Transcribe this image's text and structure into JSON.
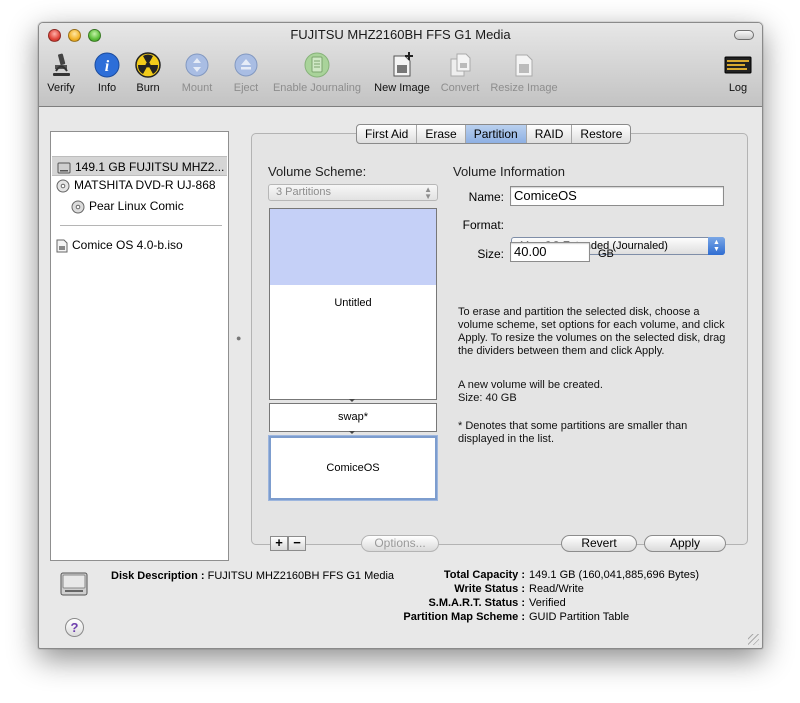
{
  "window": {
    "title": "FUJITSU MHZ2160BH FFS G1 Media"
  },
  "toolbar": {
    "items": [
      {
        "label": "Verify",
        "icon": "microscope-icon",
        "enabled": true
      },
      {
        "label": "Info",
        "icon": "info-icon",
        "enabled": true
      },
      {
        "label": "Burn",
        "icon": "burn-icon",
        "enabled": true
      },
      {
        "label": "Mount",
        "icon": "mount-icon",
        "enabled": false
      },
      {
        "label": "Eject",
        "icon": "eject-icon",
        "enabled": false
      },
      {
        "label": "Enable Journaling",
        "icon": "journaling-icon",
        "enabled": false
      },
      {
        "label": "New Image",
        "icon": "new-image-icon",
        "enabled": true
      },
      {
        "label": "Convert",
        "icon": "convert-icon",
        "enabled": false
      },
      {
        "label": "Resize Image",
        "icon": "resize-image-icon",
        "enabled": false
      },
      {
        "label": "Log",
        "icon": "log-icon",
        "enabled": true
      }
    ]
  },
  "sidebar": {
    "items": [
      {
        "label": "149.1 GB FUJITSU MHZ2...",
        "icon": "hard-disk-icon",
        "selected": true
      },
      {
        "label": "MATSHITA DVD-R UJ-868",
        "icon": "optical-drive-icon"
      },
      {
        "label": "Pear Linux Comic",
        "icon": "disc-icon"
      },
      {
        "label": "Comice OS 4.0-b.iso",
        "icon": "disk-image-icon"
      }
    ]
  },
  "tabs": [
    {
      "label": "First Aid"
    },
    {
      "label": "Erase"
    },
    {
      "label": "Partition",
      "active": true
    },
    {
      "label": "RAID"
    },
    {
      "label": "Restore"
    }
  ],
  "partition": {
    "scheme_label": "Volume Scheme:",
    "scheme_value": "3 Partitions",
    "volumes": [
      {
        "name": "Untitled",
        "used_fraction": 0.4
      },
      {
        "name": "swap*"
      },
      {
        "name": "ComiceOS",
        "selected": true
      }
    ],
    "add_label": "+",
    "remove_label": "−",
    "options_label": "Options...",
    "info_label": "Volume Information",
    "name_label": "Name:",
    "name_value": "ComiceOS",
    "format_label": "Format:",
    "format_value": "Mac OS Extended (Journaled)",
    "size_label": "Size:",
    "size_value": "40.00",
    "size_unit": "GB",
    "help_text": "To erase and partition the selected disk, choose a volume scheme, set options for each volume, and click Apply. To resize the volumes on the selected disk, drag the dividers between them and click Apply.",
    "status_line1": "A new volume will be created.",
    "status_line2": "Size: 40 GB",
    "note": "* Denotes that some partitions are smaller than displayed in the list.",
    "revert_label": "Revert",
    "apply_label": "Apply"
  },
  "disk_info": {
    "description_key": "Disk Description :",
    "description_value": "FUJITSU MHZ2160BH FFS G1 Media",
    "total_capacity_key": "Total Capacity :",
    "total_capacity_value": "149.1 GB (160,041,885,696 Bytes)",
    "write_status_key": "Write Status :",
    "write_status_value": "Read/Write",
    "smart_key": "S.M.A.R.T. Status :",
    "smart_value": "Verified",
    "scheme_key": "Partition Map Scheme :",
    "scheme_value": "GUID Partition Table"
  },
  "help_label": "?",
  "colors": {
    "accent": "#2f6dd2",
    "partition_fill": "#c5d0f7",
    "tab_active": "#9cbbe8"
  }
}
